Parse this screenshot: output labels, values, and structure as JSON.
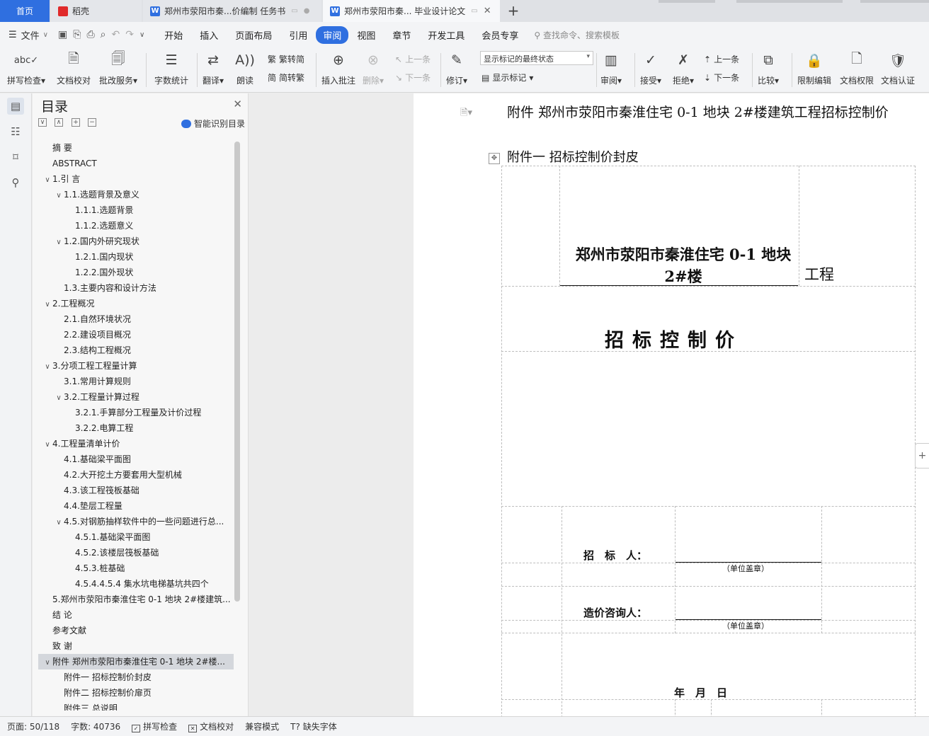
{
  "tabs": {
    "home": "首页",
    "daoke": "稻壳",
    "doc1": "郑州市荥阳市秦...价编制 任务书",
    "doc2": "郑州市荥阳市秦... 毕业设计论文"
  },
  "menu": {
    "file": "文件",
    "items": [
      "开始",
      "插入",
      "页面布局",
      "引用",
      "审阅",
      "视图",
      "章节",
      "开发工具",
      "会员专享"
    ],
    "active": "审阅",
    "search": "查找命令、搜索模板"
  },
  "ribbon": {
    "spell": "拼写检查",
    "proof": "文档校对",
    "batch": "批改服务",
    "wordcount": "字数统计",
    "translate": "翻译",
    "read": "朗读",
    "trad": "繁转简",
    "simp": "简转繁",
    "insert_comment": "插入批注",
    "delete": "删除",
    "prev_disabled": "上一条",
    "next_disabled": "下一条",
    "revise": "修订",
    "markup_state": "显示标记的最终状态",
    "show_markup": "显示标记",
    "review": "审阅",
    "accept": "接受",
    "reject": "拒绝",
    "prev": "上一条",
    "next": "下一条",
    "compare": "比较",
    "restrict": "限制编辑",
    "perm": "文档权限",
    "cert": "文档认证"
  },
  "toc": {
    "title": "目录",
    "smart": "智能识别目录",
    "items": [
      {
        "text": "摘 要",
        "level": 0,
        "caret": ""
      },
      {
        "text": "ABSTRACT",
        "level": 0,
        "caret": ""
      },
      {
        "text": "1.引 言",
        "level": 0,
        "caret": "v"
      },
      {
        "text": "1.1.选题背景及意义",
        "level": 1,
        "caret": "v"
      },
      {
        "text": "1.1.1.选题背景",
        "level": 2,
        "caret": ""
      },
      {
        "text": "1.1.2.选题意义",
        "level": 2,
        "caret": ""
      },
      {
        "text": "1.2.国内外研究现状",
        "level": 1,
        "caret": "v"
      },
      {
        "text": "1.2.1.国内现状",
        "level": 2,
        "caret": ""
      },
      {
        "text": "1.2.2.国外现状",
        "level": 2,
        "caret": ""
      },
      {
        "text": "1.3.主要内容和设计方法",
        "level": 1,
        "caret": ""
      },
      {
        "text": "2.工程概况",
        "level": 0,
        "caret": "v"
      },
      {
        "text": "2.1.自然环境状况",
        "level": 1,
        "caret": ""
      },
      {
        "text": "2.2.建设项目概况",
        "level": 1,
        "caret": ""
      },
      {
        "text": "2.3.结构工程概况",
        "level": 1,
        "caret": ""
      },
      {
        "text": "3.分项工程工程量计算",
        "level": 0,
        "caret": "v"
      },
      {
        "text": "3.1.常用计算规则",
        "level": 1,
        "caret": ""
      },
      {
        "text": "3.2.工程量计算过程",
        "level": 1,
        "caret": "v"
      },
      {
        "text": "3.2.1.手算部分工程量及计价过程",
        "level": 2,
        "caret": ""
      },
      {
        "text": "3.2.2.电算工程",
        "level": 2,
        "caret": ""
      },
      {
        "text": "4.工程量清单计价",
        "level": 0,
        "caret": "v"
      },
      {
        "text": "4.1.基础梁平面图",
        "level": 1,
        "caret": ""
      },
      {
        "text": "4.2.大开挖土方要套用大型机械",
        "level": 1,
        "caret": ""
      },
      {
        "text": "4.3.该工程筏板基础",
        "level": 1,
        "caret": ""
      },
      {
        "text": "4.4.垫层工程量",
        "level": 1,
        "caret": ""
      },
      {
        "text": "4.5.对钢筋抽样软件中的一些问题进行总...",
        "level": 1,
        "caret": "v"
      },
      {
        "text": "4.5.1.基础梁平面图",
        "level": 2,
        "caret": ""
      },
      {
        "text": "4.5.2.该楼层筏板基础",
        "level": 2,
        "caret": ""
      },
      {
        "text": "4.5.3.桩基础",
        "level": 2,
        "caret": ""
      },
      {
        "text": "4.5.4.4.5.4 集水坑电梯基坑共四个",
        "level": 2,
        "caret": ""
      },
      {
        "text": "5.郑州市荥阳市秦淮住宅 0-1 地块 2#楼建筑...",
        "level": 0,
        "caret": ""
      },
      {
        "text": "结 论",
        "level": 0,
        "caret": ""
      },
      {
        "text": "参考文献",
        "level": 0,
        "caret": ""
      },
      {
        "text": "致 谢",
        "level": 0,
        "caret": ""
      },
      {
        "text": "附件 郑州市荥阳市秦淮住宅 0-1 地块 2#楼...",
        "level": 0,
        "caret": "v",
        "selected": true
      },
      {
        "text": "附件一 招标控制价封皮",
        "level": 1,
        "caret": ""
      },
      {
        "text": "附件二 招标控制价扉页",
        "level": 1,
        "caret": ""
      },
      {
        "text": "附件三 总说明",
        "level": 1,
        "caret": ""
      }
    ]
  },
  "doc": {
    "title": "附件  郑州市荥阳市秦淮住宅 0-1 地块 2#楼建筑工程招标控制价",
    "subtitle": "附件一  招标控制价封皮",
    "project_name": "郑州市荥阳市秦淮住宅 0-1 地块 2#楼",
    "project_suffix": "工程",
    "big_title": "招标控制价",
    "tenderer": "招　标　人：",
    "consultant": "造价咨询人：",
    "seal": "（单位盖章）",
    "date": "年　月　日"
  },
  "status": {
    "page": "页面: 50/118",
    "words": "字数: 40736",
    "spell": "拼写检查",
    "proof": "文档校对",
    "compat": "兼容模式",
    "missing_font": "缺失字体"
  }
}
